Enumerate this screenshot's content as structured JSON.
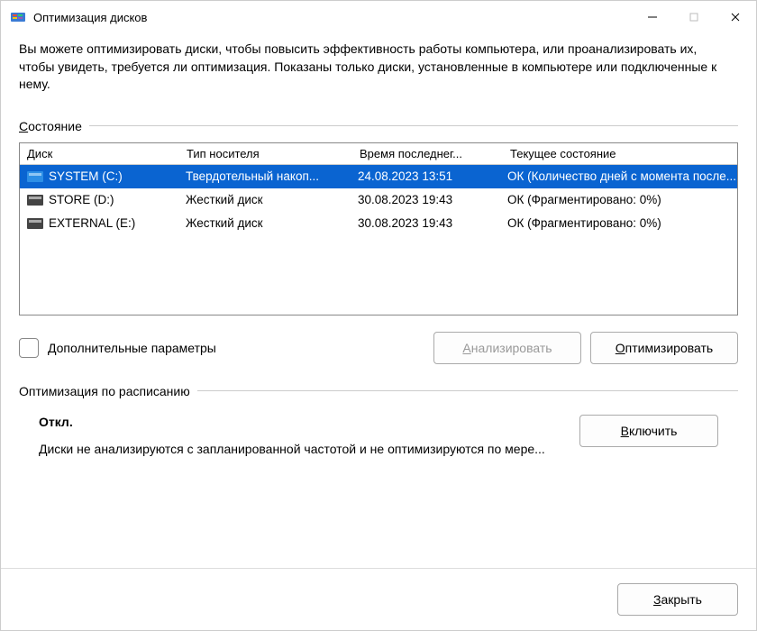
{
  "window": {
    "title": "Оптимизация дисков"
  },
  "intro": "Вы можете оптимизировать диски, чтобы повысить эффективность работы  компьютера, или проанализировать их, чтобы увидеть, требуется ли оптимизация. Показаны только диски, установленные в компьютере или подключенные к нему.",
  "sections": {
    "state_label_pre": "С",
    "state_label_rest": "остояние",
    "schedule_label": "Оптимизация по расписанию"
  },
  "columns": {
    "disc": "Диск",
    "type": "Тип носителя",
    "time": "Время последнег...",
    "state": "Текущее состояние"
  },
  "drives": [
    {
      "name": "SYSTEM (C:)",
      "type": "Твердотельный накоп...",
      "time": "24.08.2023 13:51",
      "state": "ОК (Количество дней с момента после...",
      "selected": true
    },
    {
      "name": "STORE (D:)",
      "type": "Жесткий диск",
      "time": "30.08.2023 19:43",
      "state": "ОК (Фрагментировано: 0%)",
      "selected": false
    },
    {
      "name": "EXTERNAL (E:)",
      "type": "Жесткий диск",
      "time": "30.08.2023 19:43",
      "state": "ОК (Фрагментировано: 0%)",
      "selected": false
    }
  ],
  "advanced_label": "Дополнительные параметры",
  "buttons": {
    "analyze_pre": "А",
    "analyze_rest": "нализировать",
    "optimize_pre": "О",
    "optimize_rest": "птимизировать",
    "enable_pre": "В",
    "enable_rest": "ключить",
    "close_pre": "З",
    "close_rest": "акрыть"
  },
  "schedule": {
    "status": "Откл.",
    "desc": "Диски не анализируются с запланированной частотой и не оптимизируются по мере..."
  }
}
